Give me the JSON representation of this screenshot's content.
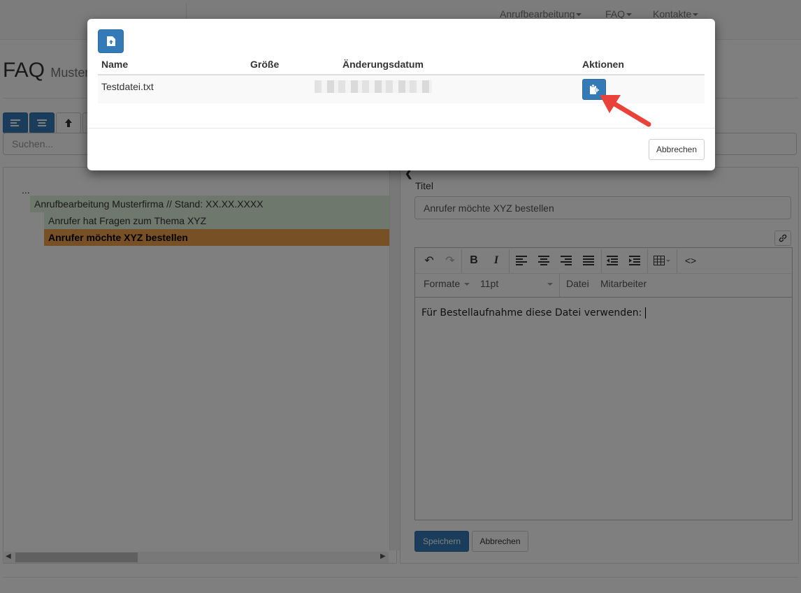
{
  "navbar": {
    "items": [
      {
        "label": "Anrufbearbeitung"
      },
      {
        "label": "FAQ"
      },
      {
        "label": "Kontakte"
      }
    ]
  },
  "page": {
    "title": "FAQ",
    "subtitle": "Muster"
  },
  "search": {
    "placeholder": "Suchen..."
  },
  "tree": {
    "root": "...",
    "items": [
      {
        "label": "Anrufbearbeitung Musterfirma // Stand: XX.XX.XXXX"
      },
      {
        "label": "Anrufer hat Fragen zum Thema XYZ"
      },
      {
        "label": "Anrufer möchte XYZ bestellen"
      }
    ]
  },
  "editor": {
    "title_label": "Titel",
    "title_value": "Anrufer möchte XYZ bestellen",
    "format_label": "Formate",
    "font_size": "11pt",
    "menu_file": "Datei",
    "menu_staff": "Mitarbeiter",
    "content": "Für Bestellaufnahme diese Datei verwenden:",
    "save_label": "Speichern",
    "cancel_label": "Abbrechen"
  },
  "modal": {
    "columns": {
      "name": "Name",
      "size": "Größe",
      "date": "Änderungsdatum",
      "actions": "Aktionen"
    },
    "rows": [
      {
        "name": "Testdatei.txt",
        "size": "",
        "date": ""
      }
    ],
    "cancel_label": "Abbrechen"
  },
  "colors": {
    "primary": "#337ab7",
    "selected": "#f0a04b",
    "tree_bg": "#dff0d8",
    "arrow": "#e8423a"
  },
  "icons": {
    "upload": "file-upload-icon",
    "insert": "paste-icon"
  }
}
